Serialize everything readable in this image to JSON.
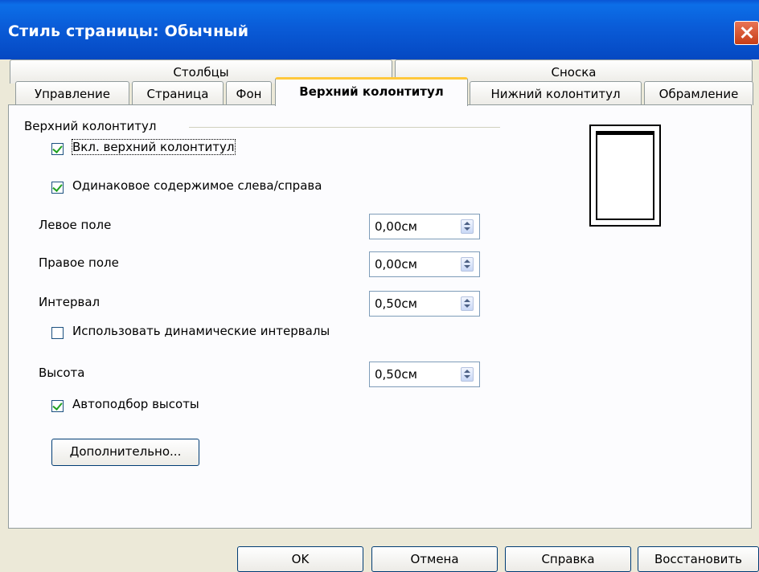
{
  "window": {
    "title": "Стиль страницы: Обычный"
  },
  "tabs_top": [
    {
      "label": "Столбцы"
    },
    {
      "label": "Сноска"
    }
  ],
  "tabs_bottom": [
    {
      "label": "Управление"
    },
    {
      "label": "Страница"
    },
    {
      "label": "Фон"
    },
    {
      "label": "Верхний колонтитул",
      "active": true
    },
    {
      "label": "Нижний колонтитул"
    },
    {
      "label": "Обрамление"
    }
  ],
  "header_group": {
    "label": "Верхний колонтитул",
    "enable": {
      "label": "Вкл. верхний колонтитул",
      "checked": true
    },
    "same_content": {
      "label": "Одинаковое содержимое слева/справа",
      "checked": true
    },
    "left_margin": {
      "label": "Левое поле",
      "value": "0,00см"
    },
    "right_margin": {
      "label": "Правое поле",
      "value": "0,00см"
    },
    "spacing": {
      "label": "Интервал",
      "value": "0,50см"
    },
    "dynamic_spacing": {
      "label": "Использовать динамические интервалы",
      "checked": false
    },
    "height": {
      "label": "Высота",
      "value": "0,50см"
    },
    "autofit": {
      "label": "Автоподбор высоты",
      "checked": true
    },
    "more_button": "Дополнительно..."
  },
  "footer_buttons": {
    "ok": "OK",
    "cancel": "Отмена",
    "help": "Справка",
    "reset": "Восстановить"
  }
}
